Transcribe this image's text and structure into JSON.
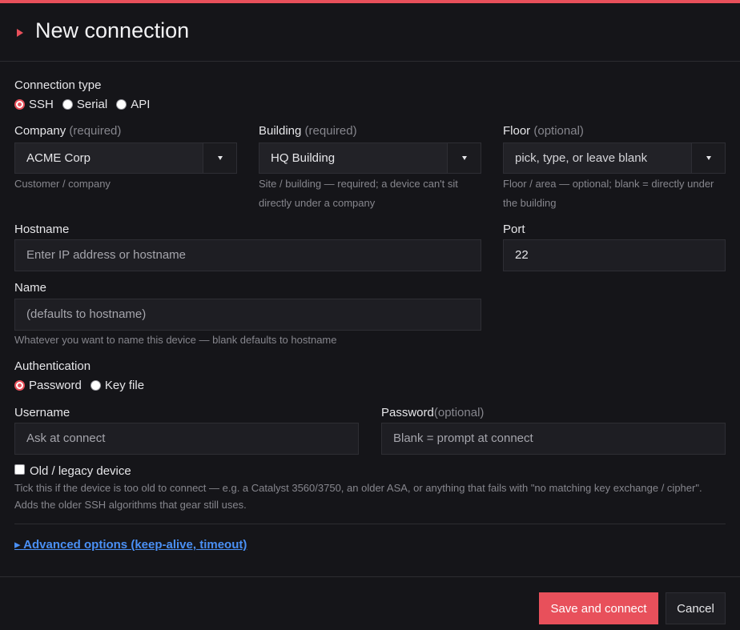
{
  "header": {
    "title": "New connection"
  },
  "connection_type": {
    "label": "Connection type",
    "options": [
      {
        "label": "SSH",
        "selected": true
      },
      {
        "label": "Serial",
        "selected": false
      },
      {
        "label": "API",
        "selected": false
      }
    ]
  },
  "company": {
    "label": "Company",
    "qualifier": "(required)",
    "value": "ACME Corp",
    "hint": "Customer / company"
  },
  "building": {
    "label": "Building",
    "qualifier": "(required)",
    "value": "HQ Building",
    "hint": "Site / building — required; a device can't sit directly under a company"
  },
  "floor": {
    "label": "Floor",
    "qualifier": "(optional)",
    "placeholder": "pick, type, or leave blank",
    "hint": "Floor / area — optional; blank = directly under the building"
  },
  "hostname": {
    "label": "Hostname",
    "placeholder": "Enter IP address or hostname"
  },
  "port": {
    "label": "Port",
    "value": "22"
  },
  "name": {
    "label": "Name",
    "placeholder": "(defaults to hostname)",
    "hint": "Whatever you want to name this device — blank defaults to hostname"
  },
  "authentication": {
    "label": "Authentication",
    "options": [
      {
        "label": "Password",
        "selected": true
      },
      {
        "label": "Key file",
        "selected": false
      }
    ]
  },
  "username": {
    "label": "Username",
    "placeholder": "Ask at connect"
  },
  "password": {
    "label": "Password",
    "qualifier": "(optional)",
    "placeholder": "Blank = prompt at connect"
  },
  "legacy": {
    "label": "Old / legacy device",
    "checked": false,
    "hint": "Tick this if the device is too old to connect — e.g. a Catalyst 3560/3750, an older ASA, or anything that fails with \"no matching key exchange / cipher\". Adds the older SSH algorithms that gear still uses."
  },
  "advanced": {
    "label": "▸ Advanced options (keep-alive, timeout)"
  },
  "footer": {
    "save_label": "Save and connect",
    "cancel_label": "Cancel"
  },
  "colors": {
    "accent": "#e8505b",
    "background": "#151519",
    "link": "#4a90f5"
  }
}
